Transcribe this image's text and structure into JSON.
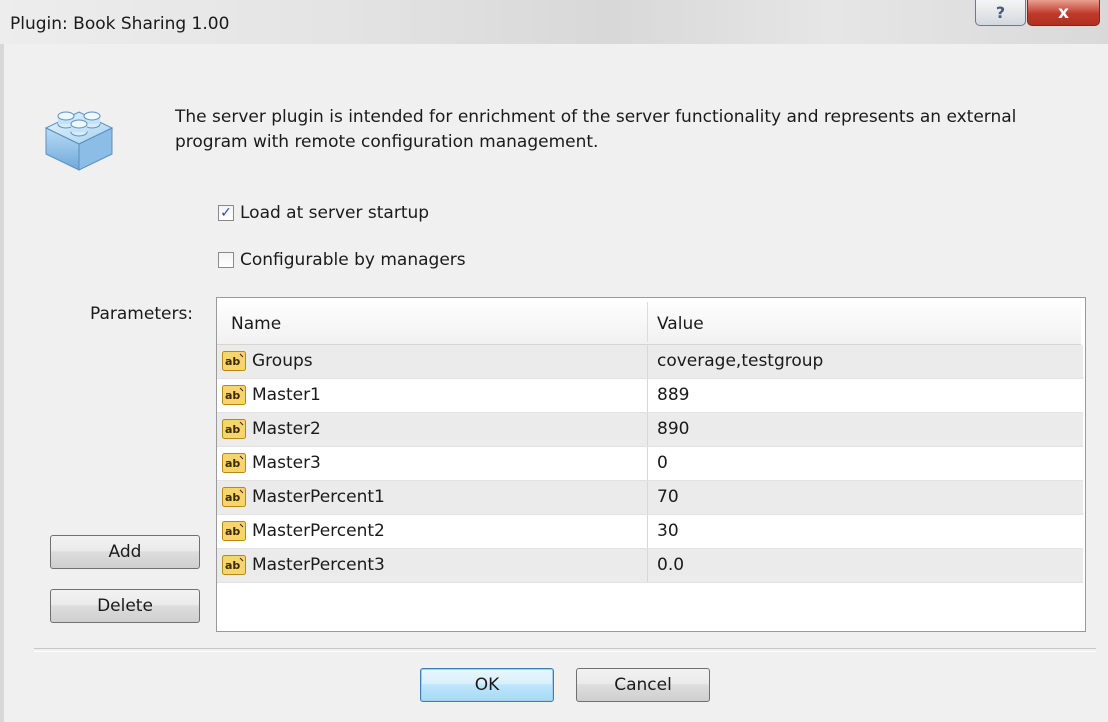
{
  "window": {
    "title": "Plugin: Book Sharing 1.00",
    "help_label": "?",
    "close_label": "x"
  },
  "description": "The server plugin is intended for enrichment of the server functionality and represents an external program with remote configuration management.",
  "options": {
    "load_at_startup": {
      "label": "Load at server startup",
      "checked": true
    },
    "configurable_by_managers": {
      "label": "Configurable by managers",
      "checked": false
    }
  },
  "parameters": {
    "label": "Parameters:",
    "columns": [
      "Name",
      "Value"
    ],
    "rows": [
      {
        "name": "Groups",
        "value": "coverage,testgroup"
      },
      {
        "name": "Master1",
        "value": "889"
      },
      {
        "name": "Master2",
        "value": "890"
      },
      {
        "name": "Master3",
        "value": "0"
      },
      {
        "name": "MasterPercent1",
        "value": "70"
      },
      {
        "name": "MasterPercent2",
        "value": "30"
      },
      {
        "name": "MasterPercent3",
        "value": "0.0"
      }
    ],
    "add_label": "Add",
    "delete_label": "Delete"
  },
  "footer": {
    "ok_label": "OK",
    "cancel_label": "Cancel"
  },
  "colors": {
    "title_bar": "#e4e4e4",
    "close_button": "#c0392b",
    "dialog_background": "#f0f0f0",
    "row_alternate": "#ebebeb",
    "default_button_border": "#3c7fb1"
  },
  "icons": {
    "plugin": "lego-brick-icon",
    "parameter": "ab-string-icon"
  }
}
